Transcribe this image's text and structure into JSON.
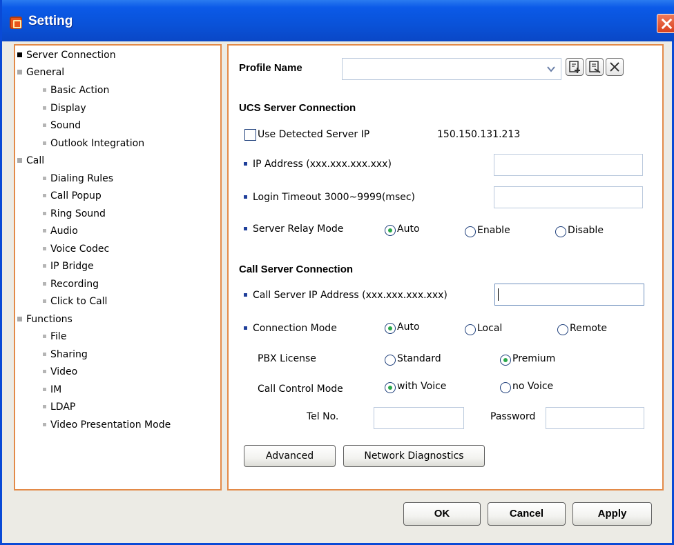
{
  "window": {
    "title": "Setting"
  },
  "nav": {
    "items": [
      {
        "label": "Server Connection",
        "level": 0,
        "active": true
      },
      {
        "label": "General",
        "level": 0
      },
      {
        "label": "Basic Action",
        "level": 1
      },
      {
        "label": "Display",
        "level": 1
      },
      {
        "label": "Sound",
        "level": 1
      },
      {
        "label": "Outlook Integration",
        "level": 1
      },
      {
        "label": "Call",
        "level": 0
      },
      {
        "label": "Dialing Rules",
        "level": 1
      },
      {
        "label": "Call Popup",
        "level": 1
      },
      {
        "label": "Ring Sound",
        "level": 1
      },
      {
        "label": "Audio",
        "level": 1
      },
      {
        "label": "Voice Codec",
        "level": 1
      },
      {
        "label": "IP Bridge",
        "level": 1
      },
      {
        "label": "Recording",
        "level": 1
      },
      {
        "label": "Click to Call",
        "level": 1
      },
      {
        "label": "Functions",
        "level": 0
      },
      {
        "label": "File",
        "level": 1
      },
      {
        "label": "Sharing",
        "level": 1
      },
      {
        "label": "Video",
        "level": 1
      },
      {
        "label": "IM",
        "level": 1
      },
      {
        "label": "LDAP",
        "level": 1
      },
      {
        "label": "Video Presentation Mode",
        "level": 1
      }
    ]
  },
  "profile": {
    "label": "Profile Name",
    "value": "",
    "icons": [
      "add-profile-icon",
      "edit-profile-icon",
      "delete-profile-icon"
    ]
  },
  "ucs": {
    "heading": "UCS Server Connection",
    "use_detected_label": "Use Detected Server IP",
    "use_detected_checked": false,
    "detected_ip": "150.150.131.213",
    "ip_label": "IP Address (xxx.xxx.xxx.xxx)",
    "ip_value": "",
    "timeout_label": "Login Timeout 3000~9999(msec)",
    "timeout_value": "",
    "relay_label": "Server Relay Mode",
    "relay_options": [
      "Auto",
      "Enable",
      "Disable"
    ],
    "relay_selected": "Auto"
  },
  "call": {
    "heading": "Call Server Connection",
    "ip_label": "Call Server IP Address (xxx.xxx.xxx.xxx)",
    "ip_value": "",
    "conn_label": "Connection Mode",
    "conn_options": [
      "Auto",
      "Local",
      "Remote"
    ],
    "conn_selected": "Auto",
    "pbx_label": "PBX License",
    "pbx_options": [
      "Standard",
      "Premium"
    ],
    "pbx_selected": "Premium",
    "control_label": "Call Control Mode",
    "control_options": [
      "with Voice",
      "no Voice"
    ],
    "control_selected": "with Voice",
    "tel_label": "Tel No.",
    "tel_value": "",
    "password_label": "Password",
    "password_value": ""
  },
  "buttons": {
    "advanced": "Advanced",
    "diagnostics": "Network Diagnostics",
    "ok": "OK",
    "cancel": "Cancel",
    "apply": "Apply"
  },
  "colors": {
    "titlebar": "#0a52d8",
    "panel_border": "#e38a48",
    "radio_selected": "#2aa84a"
  }
}
